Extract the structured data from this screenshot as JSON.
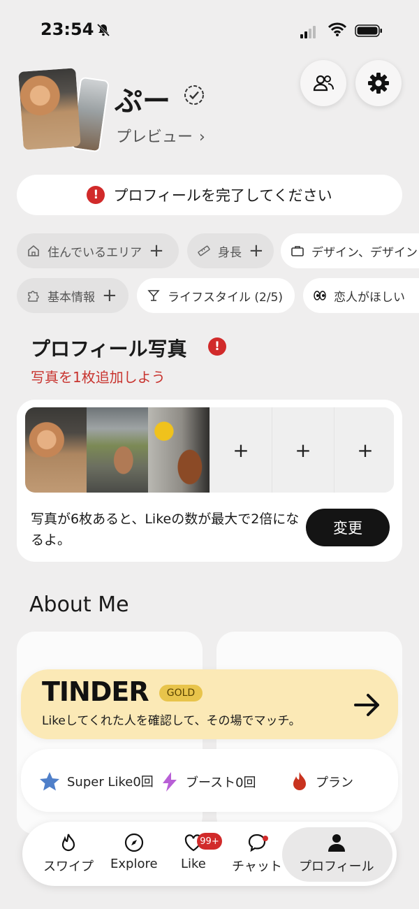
{
  "status": {
    "time": "23:54"
  },
  "profile": {
    "name": "ぷー",
    "preview": "プレビュー",
    "complete_prompt": "プロフィールを完了してください",
    "complete_icon": "!"
  },
  "chips": {
    "row1": [
      "住んでいるエリア",
      "身長",
      "デザイン、デザイン"
    ],
    "row2": [
      "基本情報",
      "ライフスタイル (2/5)",
      "恋人がほしい"
    ],
    "plus": "+"
  },
  "photos": {
    "title": "プロフィール写真",
    "alert": "!",
    "subtitle": "写真を1枚追加しよう",
    "add": "+",
    "note": "写真が6枚あると、Likeの数が最大で2倍になるよ。",
    "change_button": "変更"
  },
  "about": {
    "title": "About Me"
  },
  "gold": {
    "brand": "TINDER",
    "tier": "GOLD",
    "text": "Likeしてくれた人を確認して、その場でマッチ。"
  },
  "boosts": {
    "super_like": "Super Like0回",
    "boost": "ブースト0回",
    "plan": "プラン"
  },
  "tabs": {
    "swipe": "スワイプ",
    "explore": "Explore",
    "like": "Like",
    "like_badge": "99+",
    "chat": "チャット",
    "profile": "プロフィール"
  },
  "colors": {
    "accent_red": "#d12a2a",
    "gold_bg": "#fbe9b6",
    "gold_badge": "#e8c44b",
    "background": "#efeeee"
  }
}
